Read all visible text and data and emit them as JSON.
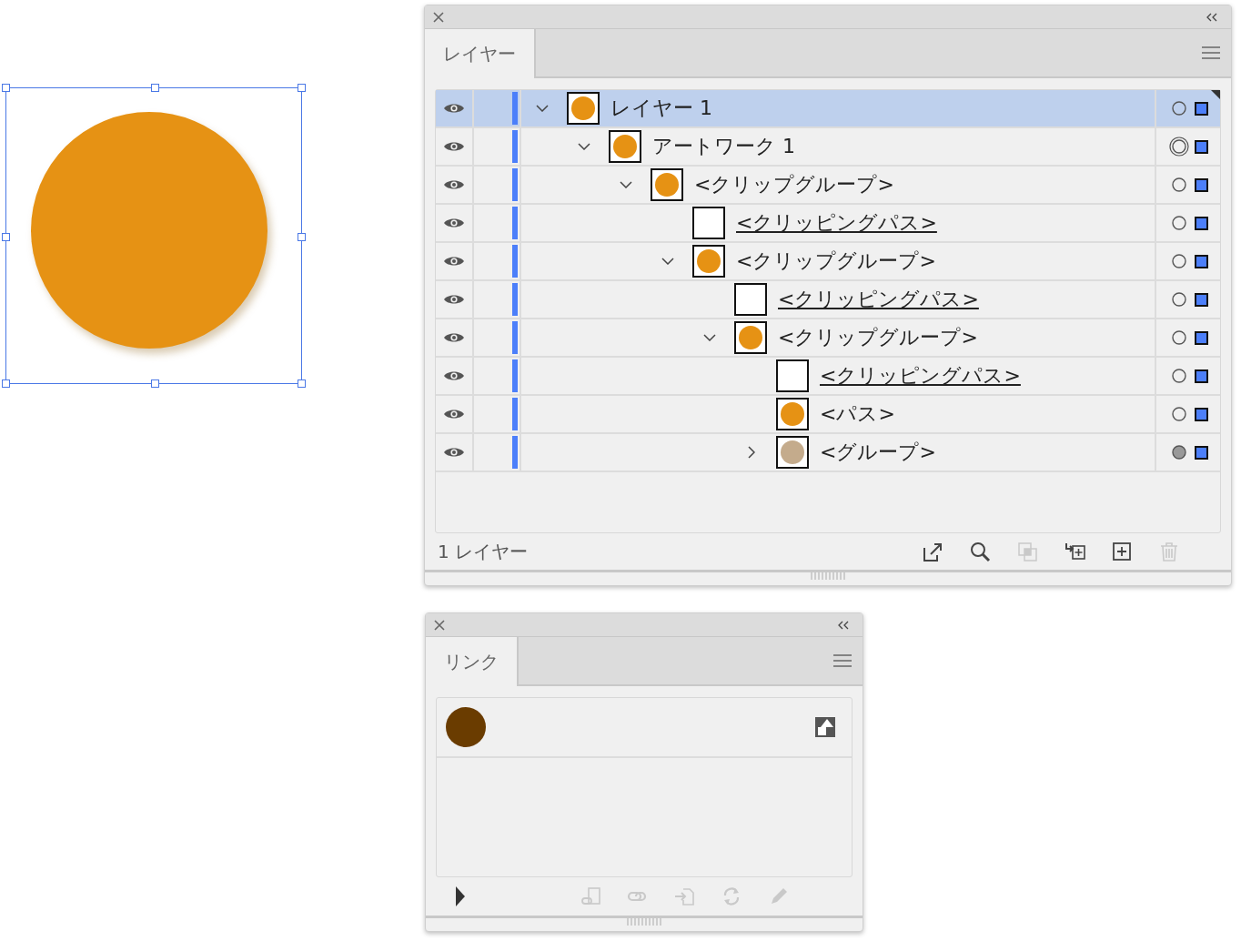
{
  "artboard": {
    "selected": true
  },
  "layers_panel": {
    "tab": "レイヤー",
    "layers": [
      {
        "name": "レイヤー 1",
        "color": "#e69214",
        "visible": true,
        "expanded": true,
        "targeted": false,
        "has_appearance": false,
        "selected": true,
        "underlined": false,
        "children": [
          {
            "name": "アートワーク 1",
            "color": "#e69214",
            "visible": true,
            "expanded": true,
            "targeted": true,
            "has_appearance": false,
            "selected": false,
            "underlined": false,
            "children": [
              {
                "name": "<クリップグループ>",
                "color": "#e69214",
                "visible": true,
                "expanded": true,
                "targeted": false,
                "has_appearance": false,
                "selected": false,
                "underlined": false,
                "children": [
                  {
                    "name": "<クリッピングパス>",
                    "visible": true,
                    "targeted": false,
                    "has_appearance": false,
                    "selected": false,
                    "underlined": true
                  },
                  {
                    "name": "<クリップグループ>",
                    "color": "#e69214",
                    "visible": true,
                    "expanded": true,
                    "targeted": false,
                    "has_appearance": false,
                    "selected": false,
                    "underlined": false,
                    "children": [
                      {
                        "name": "<クリッピングパス>",
                        "visible": true,
                        "targeted": false,
                        "has_appearance": false,
                        "selected": false,
                        "underlined": true
                      },
                      {
                        "name": "<クリップグループ>",
                        "color": "#e69214",
                        "visible": true,
                        "expanded": true,
                        "targeted": false,
                        "has_appearance": false,
                        "selected": false,
                        "underlined": false,
                        "children": [
                          {
                            "name": "<クリッピングパス>",
                            "visible": true,
                            "targeted": false,
                            "has_appearance": false,
                            "selected": false,
                            "underlined": true
                          },
                          {
                            "name": "<パス>",
                            "color": "#e69214",
                            "visible": true,
                            "targeted": false,
                            "has_appearance": false,
                            "selected": false,
                            "underlined": false
                          },
                          {
                            "name": "<グループ>",
                            "color": "#c4ab8c",
                            "visible": true,
                            "expanded": false,
                            "targeted": false,
                            "has_appearance": true,
                            "selected": false,
                            "underlined": false
                          }
                        ]
                      }
                    ]
                  }
                ]
              }
            ]
          }
        ]
      }
    ],
    "layer_count": "1 レイヤー",
    "footer_buttons": [
      {
        "kind": "export",
        "disabled": false
      },
      {
        "kind": "search",
        "disabled": false
      },
      {
        "kind": "mask",
        "disabled": true
      },
      {
        "kind": "move",
        "disabled": false
      },
      {
        "kind": "add",
        "disabled": false
      },
      {
        "kind": "trash",
        "disabled": true
      }
    ]
  },
  "links_panel": {
    "tab": "リンク",
    "links": [
      {
        "color": "#6a3c00"
      }
    ],
    "footer_buttons": [
      {
        "kind": "relink",
        "disabled": true
      },
      {
        "kind": "link",
        "disabled": true
      },
      {
        "kind": "embed",
        "disabled": true
      },
      {
        "kind": "refresh",
        "disabled": true
      },
      {
        "kind": "pencil",
        "disabled": true
      }
    ]
  }
}
